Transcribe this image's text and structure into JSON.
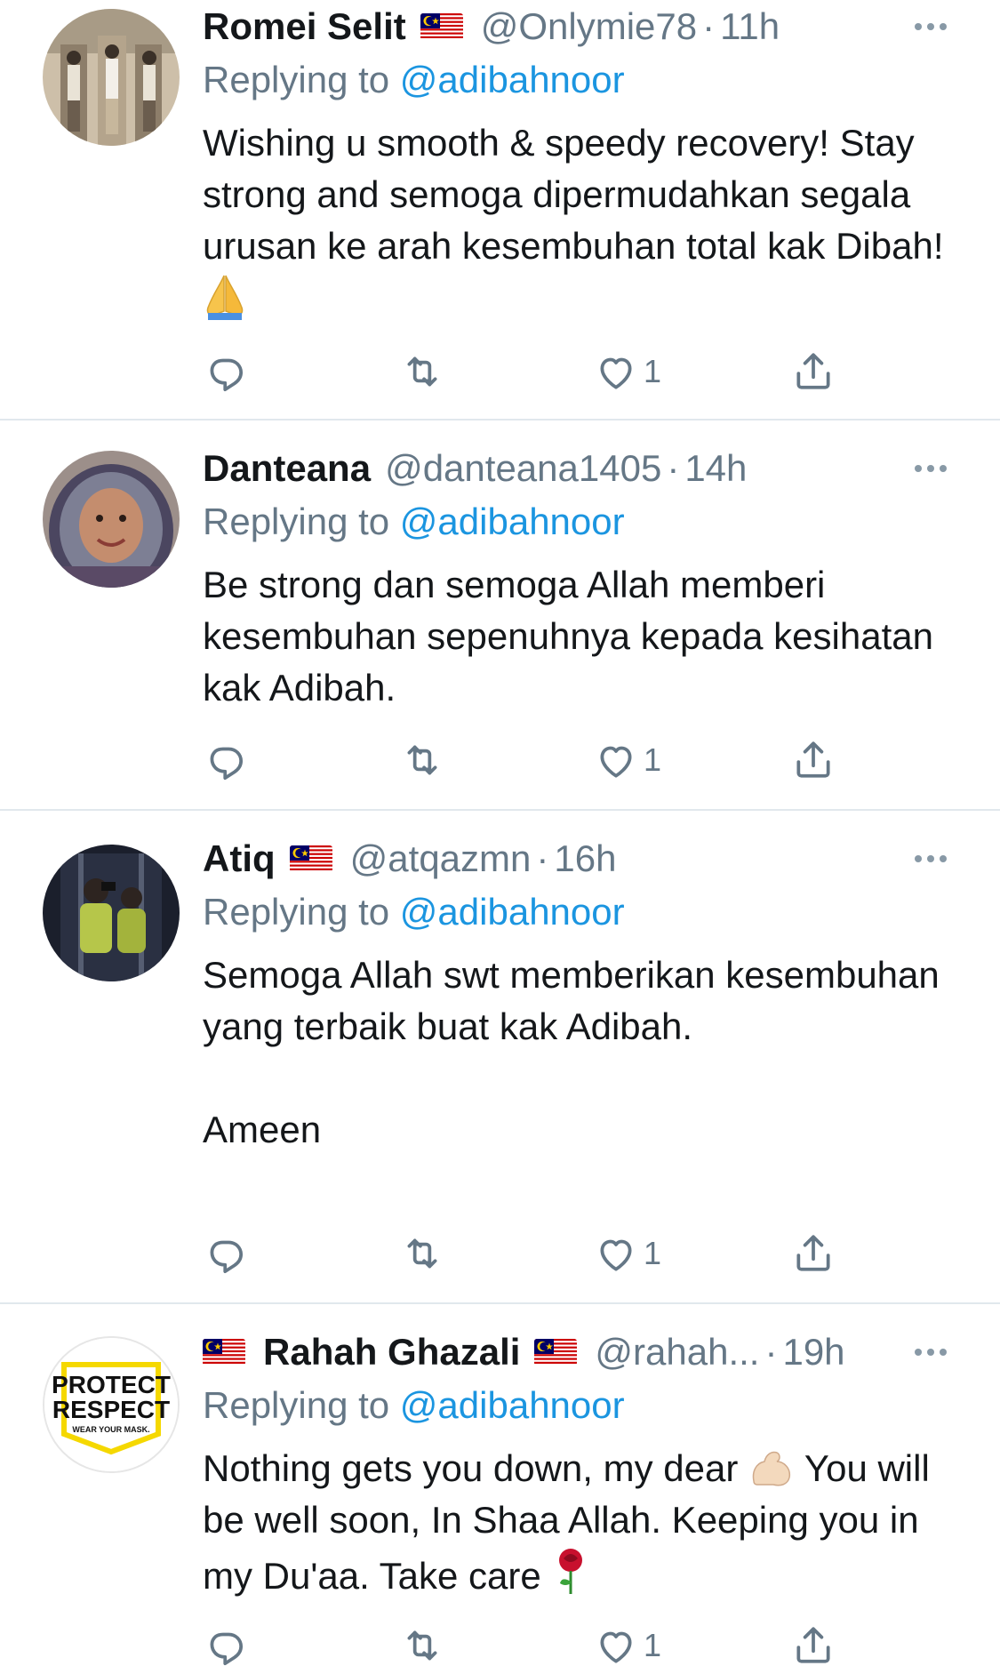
{
  "tweets": [
    {
      "name": "Romei Selit",
      "handle": "@Onlymie78",
      "dot": "·",
      "time": "11h",
      "replying_prefix": "Replying to",
      "replying_to": "@adibahnoor",
      "text": "Wishing u smooth & speedy recovery! Stay strong and semoga dipermudahkan segala urusan ke arah kesembuhan total kak Dibah!",
      "emoji": "folded-hands",
      "like_count": "1"
    },
    {
      "name": "Danteana",
      "handle": "@danteana1405",
      "dot": "·",
      "time": "14h",
      "replying_prefix": "Replying to",
      "replying_to": "@adibahnoor",
      "text": "Be strong dan semoga Allah memberi kesembuhan sepenuhnya kepada kesihatan kak Adibah.",
      "like_count": "1"
    },
    {
      "name": "Atiq",
      "handle": "@atqazmn",
      "dot": "·",
      "time": "16h",
      "replying_prefix": "Replying to",
      "replying_to": "@adibahnoor",
      "text": "Semoga Allah swt memberikan kesembuhan yang terbaik buat kak Adibah.\n\nAmeen",
      "like_count": "1"
    },
    {
      "name": "Rahah Ghazali",
      "handle": "@rahah...",
      "dot": "·",
      "time": "19h",
      "replying_prefix": "Replying to",
      "replying_to": "@adibahnoor",
      "text_part1": "Nothing gets you down, my dear",
      "text_part2": " You will be well soon, In Shaa Allah. Keeping you in my Du'aa. Take care",
      "avatar_text": [
        "PROTECT",
        "RESPECT",
        "WEAR YOUR MASK."
      ],
      "like_count": "1"
    }
  ],
  "colors": {
    "text": "#14171a",
    "secondary": "#657786",
    "link": "#1b95e0",
    "divider": "#e1e8ed"
  },
  "icons": [
    "reply-icon",
    "retweet-icon",
    "like-icon",
    "share-icon",
    "more-icon",
    "malaysia-flag-icon"
  ]
}
